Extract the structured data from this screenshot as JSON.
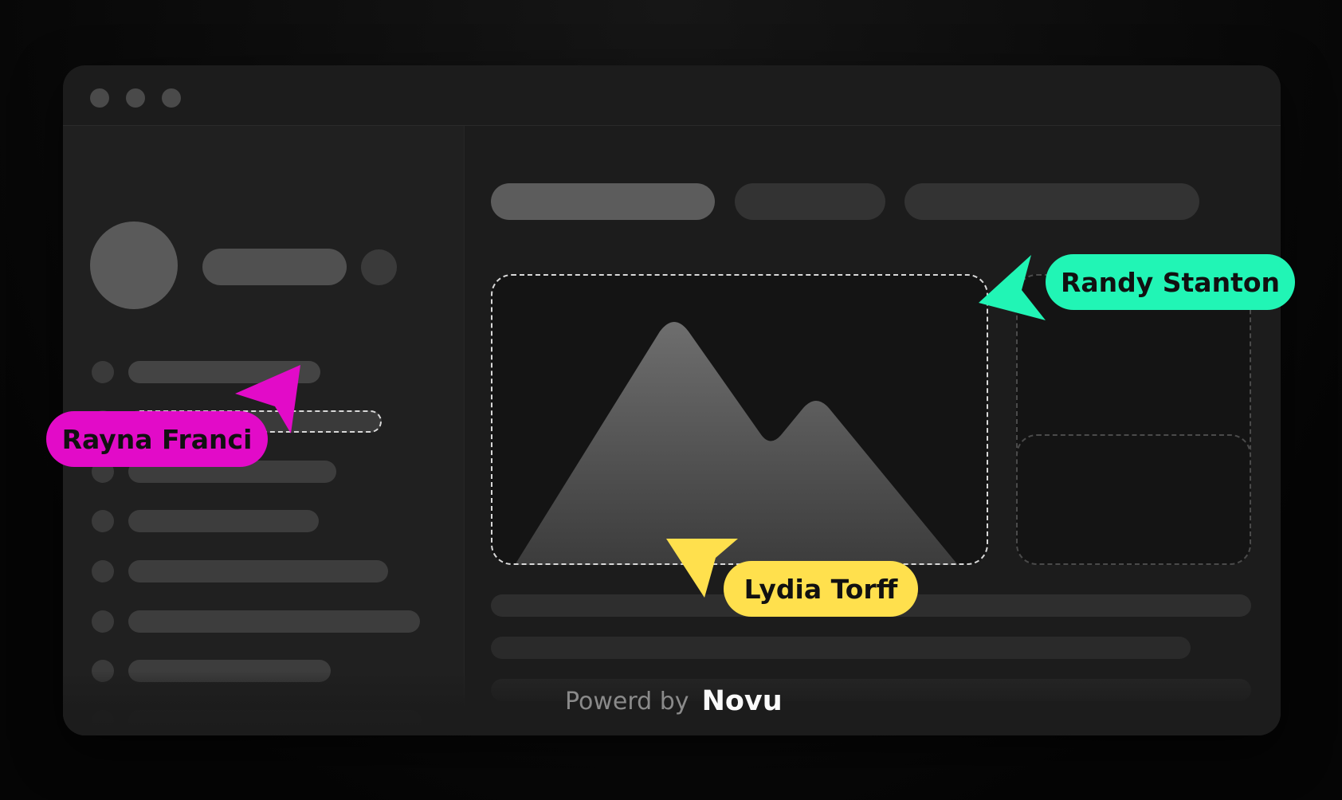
{
  "cursors": {
    "rayna": {
      "name": "Rayna Franci",
      "color": "#e20bc8"
    },
    "randy": {
      "name": "Randy Stanton",
      "color": "#21f5b5"
    },
    "lydia": {
      "name": "Lydia Torff",
      "color": "#ffe04d"
    }
  },
  "footer": {
    "prefix": "Powerd by",
    "brand": "Novu"
  },
  "icons": {
    "window_controls": [
      "window-dot-icon",
      "window-dot-icon",
      "window-dot-icon"
    ],
    "hero": "mountain-image-icon",
    "cursor": "pointer-arrow-icon"
  }
}
